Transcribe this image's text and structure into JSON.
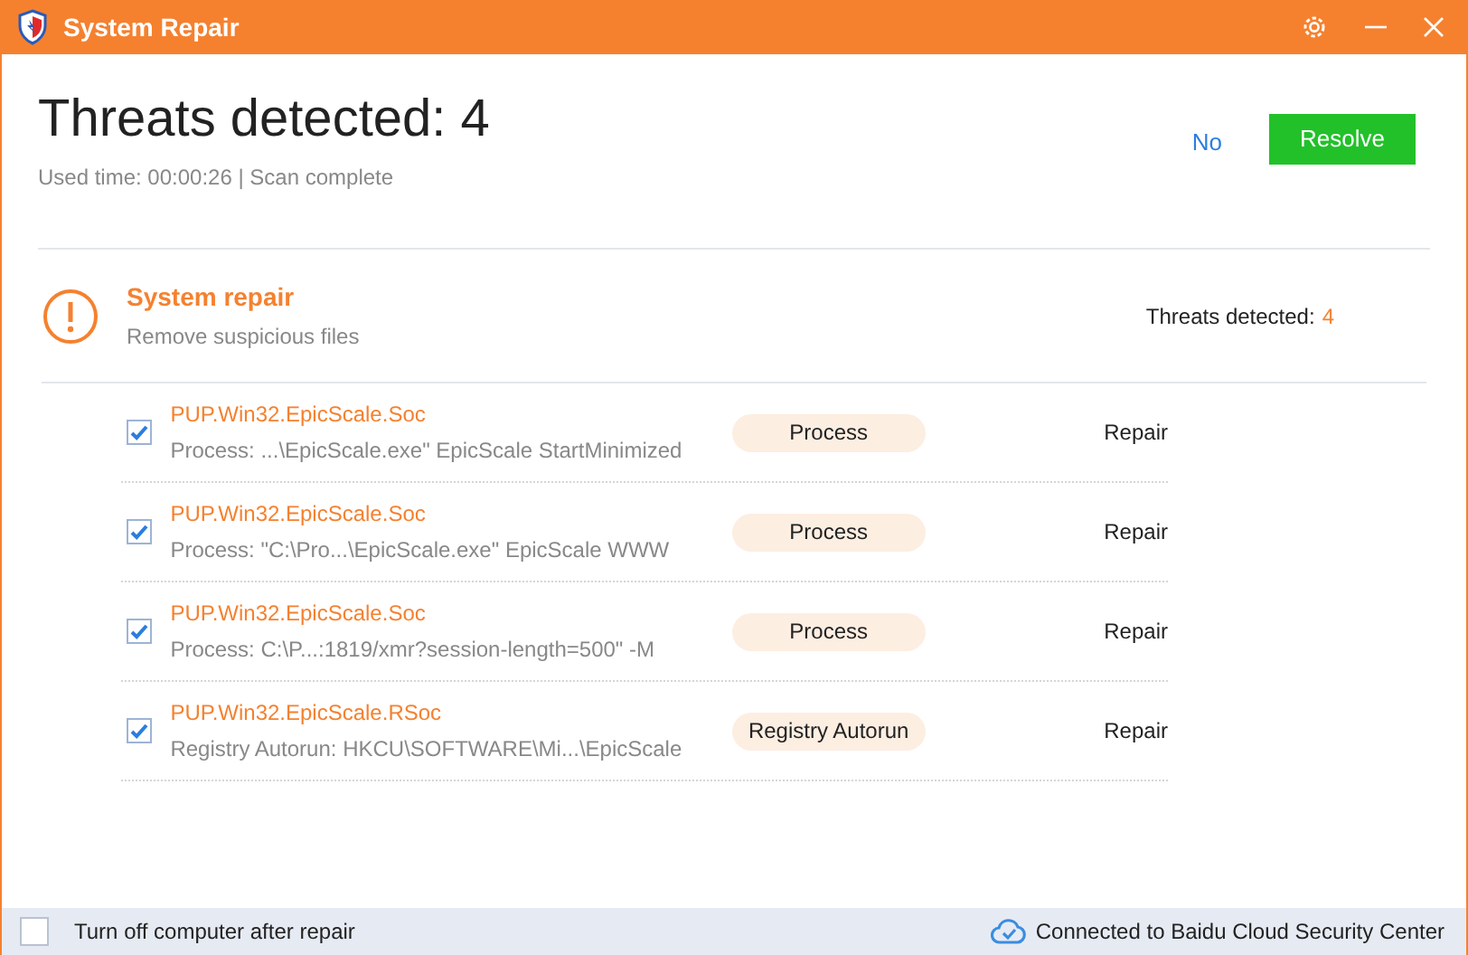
{
  "window": {
    "title": "System Repair"
  },
  "header": {
    "title": "Threats detected: 4",
    "subtitle": "Used time: 00:00:26 | Scan complete",
    "no_link": "No",
    "resolve_button": "Resolve"
  },
  "section": {
    "title": "System repair",
    "subtitle": "Remove suspicious files",
    "count_label": "Threats detected:",
    "count": "4"
  },
  "threats": [
    {
      "name": "PUP.Win32.EpicScale.Soc",
      "detail": "Process: ...\\EpicScale.exe\" EpicScale StartMinimized",
      "type": "Process",
      "action": "Repair",
      "checked": true
    },
    {
      "name": "PUP.Win32.EpicScale.Soc",
      "detail": "Process: \"C:\\Pro...\\EpicScale.exe\" EpicScale WWW",
      "type": "Process",
      "action": "Repair",
      "checked": true
    },
    {
      "name": "PUP.Win32.EpicScale.Soc",
      "detail": "Process: C:\\P...:1819/xmr?session-length=500\" -M",
      "type": "Process",
      "action": "Repair",
      "checked": true
    },
    {
      "name": "PUP.Win32.EpicScale.RSoc",
      "detail": "Registry Autorun: HKCU\\SOFTWARE\\Mi...\\EpicScale",
      "type": "Registry Autorun",
      "action": "Repair",
      "checked": true
    }
  ],
  "footer": {
    "shutdown_label": "Turn off computer after repair",
    "shutdown_checked": false,
    "status": "Connected to Baidu Cloud Security Center"
  }
}
